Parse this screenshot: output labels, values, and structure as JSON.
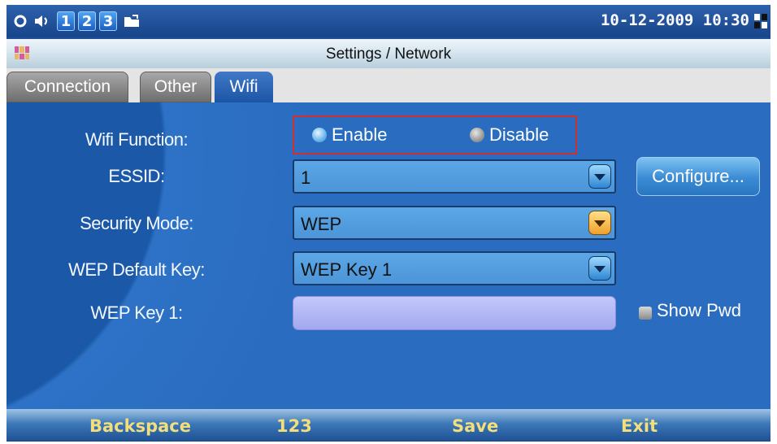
{
  "status_bar": {
    "icons": [
      "circle-icon",
      "speaker-icon",
      "line-1",
      "line-2",
      "line-3",
      "folder-icon"
    ],
    "lines": [
      "1",
      "2",
      "3"
    ],
    "datetime": "10-12-2009 10:30"
  },
  "title_bar": {
    "title": "Settings / Network"
  },
  "tabs": [
    {
      "label": "Connection",
      "active": false
    },
    {
      "label": "Other",
      "active": false
    },
    {
      "label": "Wifi",
      "active": true
    }
  ],
  "form": {
    "wifi_function": {
      "label": "Wifi Function:",
      "options": [
        "Enable",
        "Disable"
      ],
      "selected": "Enable"
    },
    "essid": {
      "label": "ESSID:",
      "value": "1"
    },
    "security_mode": {
      "label": "Security Mode:",
      "value": "WEP"
    },
    "wep_default_key": {
      "label": "WEP Default Key:",
      "value": "WEP Key 1"
    },
    "wep_key_1": {
      "label": "WEP Key 1:",
      "value": ""
    },
    "configure_button": "Configure...",
    "show_pwd": {
      "label": "Show Pwd",
      "checked": false
    }
  },
  "softkeys": [
    "Backspace",
    "123",
    "Save",
    "Exit"
  ],
  "colors": {
    "background": "#1f4f97",
    "softkey_text": "#f2de7a",
    "highlight_border": "#d03030"
  }
}
